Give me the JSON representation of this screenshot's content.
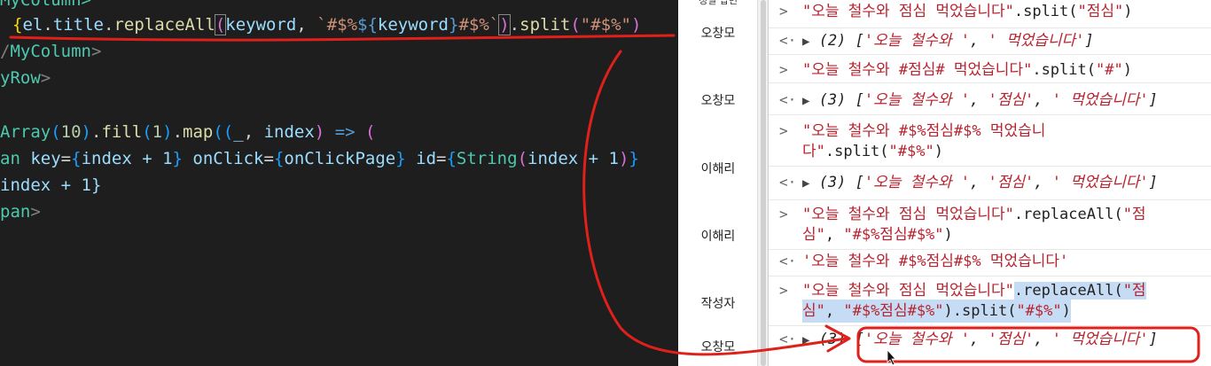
{
  "editor": {
    "line0": "MyColumn>",
    "line1": {
      "open": "{",
      "el": "el",
      "dot1": ".",
      "title": "title",
      "dot2": ".",
      "replaceAll": "replaceAll",
      "p_open": "(",
      "keyword": "keyword",
      "comma": ", ",
      "tpl_open": "`#$%",
      "tpl_expr_open": "${",
      "tpl_keyword": "keyword",
      "tpl_expr_close": "}",
      "tpl_close": "#$%`",
      "p_close": ")",
      "dot3": ".",
      "split": "split",
      "s_open": "(",
      "split_arg": "\"#$%\"",
      "s_close": ")"
    },
    "line2": {
      "slash": "/",
      "tag": "MyColumn",
      "close": ">"
    },
    "line3": {
      "tag": "yRow",
      "close": ">"
    },
    "line5": {
      "array": "Array",
      "p1": "(",
      "num10": "10",
      "p1c": ")",
      "dot": ".",
      "fill": "fill",
      "p2": "(",
      "num1": "1",
      "p2c": ")",
      "dot2": ".",
      "map": "map",
      "p3": "((",
      "under": "_",
      "comma": ", ",
      "index": "index",
      "p3c": ")",
      "arrow": " => ",
      "p4": "("
    },
    "line6": {
      "tag": "an",
      "key_attr": " key",
      "eq1": "=",
      "b1o": "{",
      "expr1": "index + 1",
      "b1c": "}",
      "onclick_attr": " onClick",
      "eq2": "=",
      "b2o": "{",
      "expr2": "onClickPage",
      "b2c": "}",
      "id_attr": " id",
      "eq3": "=",
      "b3o": "{",
      "string_fn": "String",
      "p_o": "(",
      "expr3": "index + 1",
      "p_c": ")",
      "b3c": "}"
    },
    "line7": "index + 1}",
    "line8": {
      "tag": "pan",
      "close": ">"
    }
  },
  "table": {
    "header": "정렬 답변",
    "writers": [
      "오창모",
      "오창모",
      "이해리",
      "이해리",
      "작성자",
      "오창모"
    ]
  },
  "console": {
    "entries": [
      {
        "input_str": "\"오늘 철수와 점심 먹었습니다\"",
        "input_fn": ".split(",
        "input_arg": "\"점심\"",
        "input_end": ")"
      },
      {
        "result_count": "(2)",
        "result_items": [
          "'오늘 철수와 '",
          "' 먹었습니다'"
        ]
      },
      {
        "input_str": "\"오늘 철수와 #점심# 먹었습니다\"",
        "input_fn": ".split(",
        "input_arg": "\"#\"",
        "input_end": ")"
      },
      {
        "result_count": "(3)",
        "result_items": [
          "'오늘 철수와 '",
          "'점심'",
          "' 먹었습니다'"
        ]
      },
      {
        "input_str_line1": "\"오늘 철수와 #$%점심#$% 먹었습니",
        "input_str_line2": "다\"",
        "input_fn": ".split(",
        "input_arg": "\"#$%\"",
        "input_end": ")"
      },
      {
        "result_count": "(3)",
        "result_items": [
          "'오늘 철수와 '",
          "'점심'",
          "' 먹었습니다'"
        ]
      },
      {
        "input_str": "\"오늘 철수와 점심 먹었습니다\"",
        "input_fn": ".replaceAll(",
        "input_arg1_line1": "\"점",
        "input_arg1_line2": "심\"",
        "comma": ", ",
        "input_arg2": "\"#$%점심#$%\"",
        "input_end": ")"
      },
      {
        "result_str": "'오늘 철수와 #$%점심#$% 먹었습니다'"
      },
      {
        "input_str": "\"오늘 철수와 점심 먹었습니다\"",
        "input_fn": ".replaceAll(",
        "input_arg1_line1": "\"점",
        "input_arg1_line2": "심\"",
        "comma": ", ",
        "input_arg2": "\"#$%점심#$%\"",
        "input_end": ")",
        "input_fn2": ".split(",
        "input_arg3": "\"#$%\"",
        "input_end2": ")"
      },
      {
        "result_count": "(3)",
        "result_items": [
          "'오늘 철수와 '",
          "'점심'",
          "' 먹었습니다'"
        ]
      }
    ],
    "prompt_in": ">",
    "prompt_out": "<·",
    "triangle": "▶",
    "open_bracket": "[",
    "close_bracket": "]",
    "sep": ", "
  },
  "colors": {
    "annotation_red": "#e0201b",
    "string_red": "#b8232f",
    "selection_blue": "#c6dcf5"
  }
}
